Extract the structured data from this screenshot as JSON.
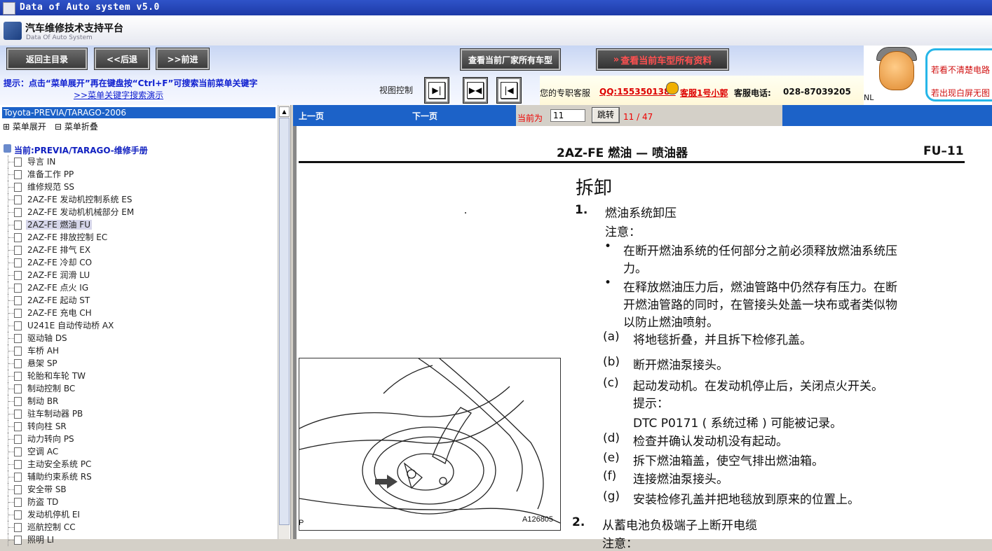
{
  "window": {
    "title": "Data of Auto system v5.0"
  },
  "header": {
    "title": "汽车维修技术支持平台",
    "subtitle": "Data Of Auto System"
  },
  "toolbar": {
    "home": "返回主目录",
    "back": "<<后退",
    "forward": ">>前进",
    "all_models": "查看当前厂家所有车型",
    "all_data": "查看当前车型所有资料"
  },
  "hint": {
    "text": "提示：点击“菜单展开”再在键盘按“Ctrl+F”可搜索当前菜单关键字",
    "demo_link": ">>菜单关键字搜索演示",
    "view_control": "视图控制"
  },
  "customer_service": {
    "label": "您的专职客服",
    "qq": "QQ:1553501388",
    "agent": "客服1号小郭",
    "phone_label": "客服电话:",
    "phone": "028-87039205"
  },
  "ad": {
    "line1": "若看不清楚电路",
    "line2": "若出现白屏无图",
    "nl": "NL"
  },
  "tree": {
    "header": "Toyota-PREVIA/TARAGO-2006",
    "expand": "菜单展开",
    "collapse": "菜单折叠",
    "current": "当前:PREVIA/TARAGO-维修手册",
    "items": [
      "导言 IN",
      "准备工作 PP",
      "维修规范 SS",
      "2AZ-FE 发动机控制系统 ES",
      "2AZ-FE 发动机机械部分 EM",
      "2AZ-FE 燃油 FU",
      "2AZ-FE 排放控制 EC",
      "2AZ-FE 排气 EX",
      "2AZ-FE 冷却 CO",
      "2AZ-FE 润滑 LU",
      "2AZ-FE 点火 IG",
      "2AZ-FE 起动 ST",
      "2AZ-FE 充电 CH",
      "U241E 自动传动桥 AX",
      "驱动轴 DS",
      "车桥 AH",
      "悬架 SP",
      "轮胎和车轮 TW",
      "制动控制 BC",
      "制动 BR",
      "驻车制动器 PB",
      "转向柱 SR",
      "动力转向 PS",
      "空调 AC",
      "主动安全系统 PC",
      "辅助约束系统 RS",
      "安全带 SB",
      "防盗 TD",
      "发动机停机 EI",
      "巡航控制 CC",
      "照明 LI"
    ],
    "selected_index": 5
  },
  "pager": {
    "prev": "上一页",
    "next": "下一页",
    "current_label": "当前为",
    "page_value": "11",
    "go": "跳转",
    "page_info": "11 / 47"
  },
  "document": {
    "section_title": "2AZ-FE 燃油 — 喷油器",
    "page_code": "FU–11",
    "heading": "拆卸",
    "step1_num": "1.",
    "step1_title": "燃油系统卸压",
    "notice": "注意：",
    "bullet1_a": "在断开燃油系统的任何部分之前必须释放燃油系统压",
    "bullet1_b": "力。",
    "bullet2_a": "在释放燃油压力后，燃油管路中仍然存有压力。在断",
    "bullet2_b": "开燃油管路的同时，在管接头处盖一块布或者类似物",
    "bullet2_c": "以防止燃油喷射。",
    "a_label": "(a)",
    "a_text": "将地毯折叠，并且拆下检修孔盖。",
    "b_label": "(b)",
    "b_text": "断开燃油泵接头。",
    "c_label": "(c)",
    "c_text": "起动发动机。在发动机停止后，关闭点火开关。",
    "tip": "提示：",
    "dtc": "DTC P0171 ( 系统过稀 ) 可能被记录。",
    "d_label": "(d)",
    "d_text": "检查并确认发动机没有起动。",
    "e_label": "(e)",
    "e_text": "拆下燃油箱盖，使空气排出燃油箱。",
    "f_label": "(f)",
    "f_text": "连接燃油泵接头。",
    "g_label": "(g)",
    "g_text": "安装检修孔盖并把地毯放到原来的位置上。",
    "step2_num": "2.",
    "step2_title": "从蓄电池负极端子上断开电缆",
    "step2_notice": "注意：",
    "figure_id": "A126805",
    "figure_p": "P"
  }
}
